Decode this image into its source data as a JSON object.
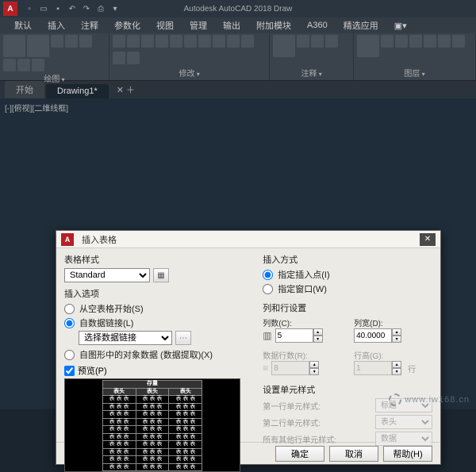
{
  "app": {
    "title": "Autodesk AutoCAD 2018    Draw",
    "logo": "A"
  },
  "qat": [
    "new",
    "open",
    "save",
    "undo",
    "redo",
    "plot"
  ],
  "menubar": [
    "默认",
    "插入",
    "注释",
    "参数化",
    "视图",
    "管理",
    "输出",
    "附加模块",
    "A360",
    "精选应用"
  ],
  "ribbon": [
    {
      "label": "绘图"
    },
    {
      "label": "修改"
    },
    {
      "label": "注释"
    },
    {
      "label": "图层"
    }
  ],
  "tabs": {
    "start": "开始",
    "active": "Drawing1*"
  },
  "viewport_label": "[-][俯视][二维线框]",
  "dialog": {
    "title": "插入表格",
    "left": {
      "style_label": "表格样式",
      "style_value": "Standard",
      "insert_options_label": "插入选项",
      "opt_empty": "从空表格开始(S)",
      "opt_link": "自数据链接(L)",
      "link_select": "选择数据链接",
      "opt_extract": "自图形中的对象数据 (数据提取)(X)",
      "preview_label": "预览(P)",
      "preview_header": "存量",
      "preview_cell": "表头",
      "preview_data": "表 表 表"
    },
    "right": {
      "insert_mode_label": "插入方式",
      "mode_point": "指定插入点(I)",
      "mode_window": "指定窗口(W)",
      "rowcol_label": "列和行设置",
      "cols_label": "列数(C):",
      "cols_value": "5",
      "colw_label": "列宽(D):",
      "colw_value": "40.0000",
      "datarows_label": "数据行数(R):",
      "datarows_value": "8",
      "rowh_label": "行高(G):",
      "rowh_value": "1",
      "rowh_unit": "行",
      "cellstyle_label": "设置单元样式",
      "first_row": "第一行单元样式:",
      "first_val": "标题",
      "second_row": "第二行单元样式:",
      "second_val": "表头",
      "other_row": "所有其他行单元样式:",
      "other_val": "数据"
    },
    "buttons": {
      "ok": "确定",
      "cancel": "取消",
      "help": "帮助(H)"
    }
  },
  "watermark": "www.iw168.cn"
}
